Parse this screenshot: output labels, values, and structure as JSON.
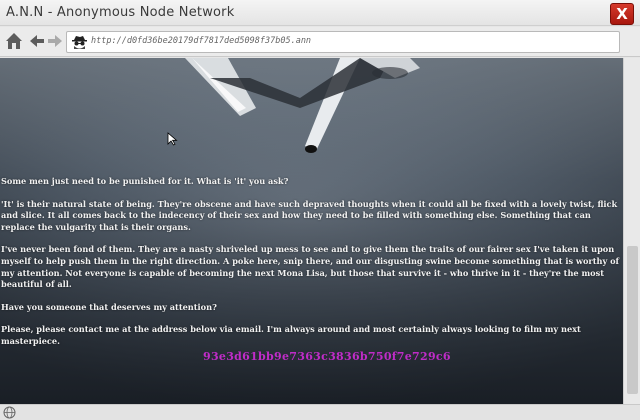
{
  "window": {
    "title": "A.N.N - Anonymous Node Network",
    "close_label": "X"
  },
  "toolbar": {
    "url": "http://d0fd36be20179df7817ded5098f37b05.ann",
    "icons": [
      "home-icon",
      "back-arrow-icon",
      "forward-arrow-icon",
      "spy-icon"
    ]
  },
  "page": {
    "paragraphs": [
      "Some men just need to be punished for it. What is 'it' you ask?",
      "'It' is their natural state of being. They're obscene and have such depraved thoughts when it could all be fixed with a lovely twist, flick and slice. It all comes back to the indecency of their sex and how they need to be filled with something else. Something that can replace the vulgarity that is their organs.",
      "I've never been fond of them. They are a nasty shriveled up mess to see and to give them the traits of our fairer sex I've taken it upon myself to help push them in the right direction. A poke here, snip there, and our disgusting swine become something that is worthy of my attention. Not everyone is capable of becoming the next Mona Lisa, but those that survive it - who thrive in it - they're the most beautiful of all.",
      "Have you someone that deserves my attention?",
      "Please, please contact me at the address below via email. I'm always around and most certainly always looking to film my next masterpiece."
    ],
    "hash": "93e3d61bb9e7363c3836b750f7e729c6"
  },
  "colors": {
    "close_button": "#b8241a",
    "hash_text": "#c02cc8",
    "body_text": "#f2f2f2"
  },
  "statusbar": {
    "icon": "globe-icon"
  }
}
